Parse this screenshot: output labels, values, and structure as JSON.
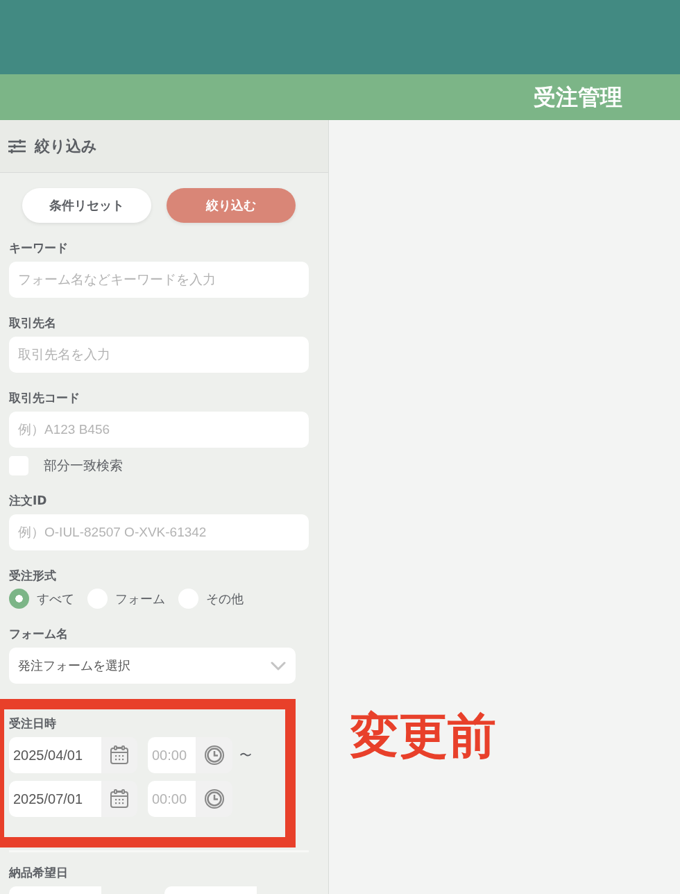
{
  "header": {
    "title": "受注管理"
  },
  "filter_panel": {
    "title": "絞り込み",
    "buttons": [
      {
        "label": "条件リセット",
        "kind": "reset"
      },
      {
        "label": "絞り込む",
        "kind": "apply"
      }
    ],
    "fields": [
      {
        "kind": "text",
        "label": "キーワード",
        "placeholder": "フォーム名などキーワードを入力"
      },
      {
        "kind": "text",
        "label": "取引先名",
        "placeholder": "取引先名を入力"
      },
      {
        "kind": "text",
        "label": "取引先コード",
        "placeholder": "例）A123 B456",
        "checkbox": {
          "label": "部分一致検索",
          "checked": false
        }
      },
      {
        "kind": "text",
        "label": "注文ID",
        "placeholder": "例）O-IUL-82507 O-XVK-61342"
      },
      {
        "kind": "radio",
        "label": "受注形式",
        "options": [
          {
            "label": "すべて",
            "selected": true
          },
          {
            "label": "フォーム",
            "selected": false
          },
          {
            "label": "その他",
            "selected": false
          }
        ]
      },
      {
        "kind": "select",
        "label": "フォーム名",
        "value": "発注フォームを選択"
      },
      {
        "kind": "datetime_range",
        "label": "受注日時",
        "highlighted": true,
        "rows": [
          {
            "date": "2025/04/01",
            "time_placeholder": "00:00",
            "separator": "〜"
          },
          {
            "date": "2025/07/01",
            "time_placeholder": "00:00"
          }
        ]
      },
      {
        "kind": "date_range",
        "label": "納品希望日",
        "inputs": [
          {
            "kind": "date"
          },
          {
            "kind": "date"
          }
        ]
      }
    ]
  },
  "annotation": {
    "text": "変更前"
  }
}
